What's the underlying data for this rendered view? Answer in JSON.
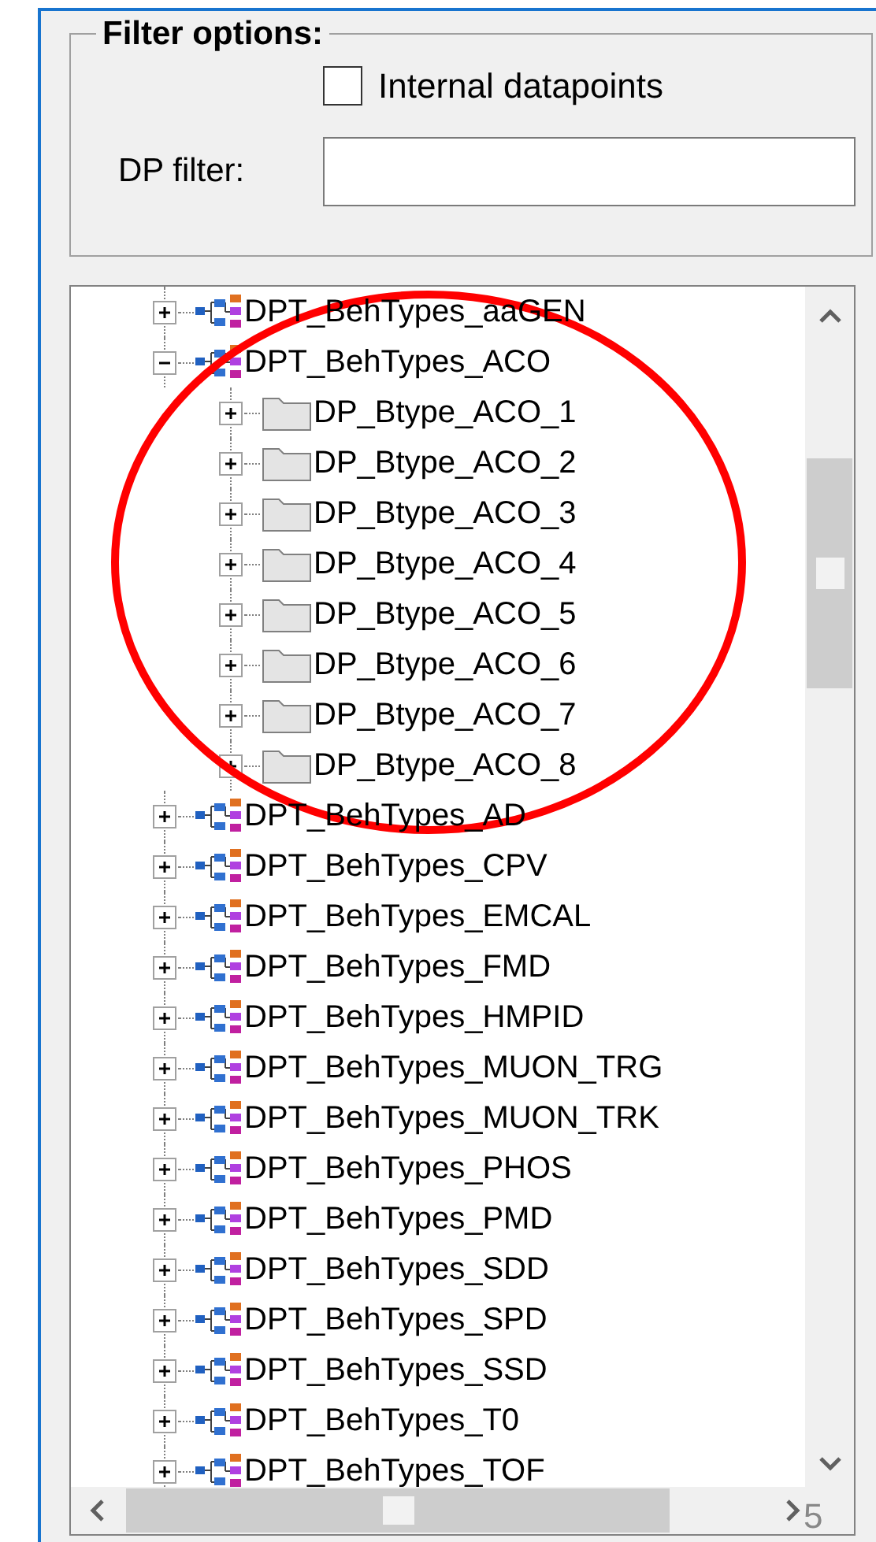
{
  "filter_group": {
    "title": "Filter options:",
    "internal_datapoints": {
      "label": "Internal datapoints",
      "checked": false
    },
    "dp_filter": {
      "label": "DP filter:"
    }
  },
  "tree": {
    "items": [
      {
        "label": "DPT_BehTypes_aaGEN",
        "kind": "type",
        "expanded": false
      },
      {
        "label": "DPT_BehTypes_ACO",
        "kind": "type",
        "expanded": true,
        "children": [
          {
            "label": "DP_Btype_ACO_1",
            "kind": "folder",
            "expanded": false
          },
          {
            "label": "DP_Btype_ACO_2",
            "kind": "folder",
            "expanded": false
          },
          {
            "label": "DP_Btype_ACO_3",
            "kind": "folder",
            "expanded": false
          },
          {
            "label": "DP_Btype_ACO_4",
            "kind": "folder",
            "expanded": false
          },
          {
            "label": "DP_Btype_ACO_5",
            "kind": "folder",
            "expanded": false
          },
          {
            "label": "DP_Btype_ACO_6",
            "kind": "folder",
            "expanded": false
          },
          {
            "label": "DP_Btype_ACO_7",
            "kind": "folder",
            "expanded": false
          },
          {
            "label": "DP_Btype_ACO_8",
            "kind": "folder",
            "expanded": false
          }
        ]
      },
      {
        "label": "DPT_BehTypes_AD",
        "kind": "type",
        "expanded": false
      },
      {
        "label": "DPT_BehTypes_CPV",
        "kind": "type",
        "expanded": false
      },
      {
        "label": "DPT_BehTypes_EMCAL",
        "kind": "type",
        "expanded": false
      },
      {
        "label": "DPT_BehTypes_FMD",
        "kind": "type",
        "expanded": false
      },
      {
        "label": "DPT_BehTypes_HMPID",
        "kind": "type",
        "expanded": false
      },
      {
        "label": "DPT_BehTypes_MUON_TRG",
        "kind": "type",
        "expanded": false
      },
      {
        "label": "DPT_BehTypes_MUON_TRK",
        "kind": "type",
        "expanded": false
      },
      {
        "label": "DPT_BehTypes_PHOS",
        "kind": "type",
        "expanded": false
      },
      {
        "label": "DPT_BehTypes_PMD",
        "kind": "type",
        "expanded": false
      },
      {
        "label": "DPT_BehTypes_SDD",
        "kind": "type",
        "expanded": false
      },
      {
        "label": "DPT_BehTypes_SPD",
        "kind": "type",
        "expanded": false
      },
      {
        "label": "DPT_BehTypes_SSD",
        "kind": "type",
        "expanded": false
      },
      {
        "label": "DPT_BehTypes_T0",
        "kind": "type",
        "expanded": false
      },
      {
        "label": "DPT_BehTypes_TOF",
        "kind": "type",
        "expanded": false
      }
    ]
  },
  "annotation": {
    "kind": "ellipse"
  },
  "corner_label": "5"
}
